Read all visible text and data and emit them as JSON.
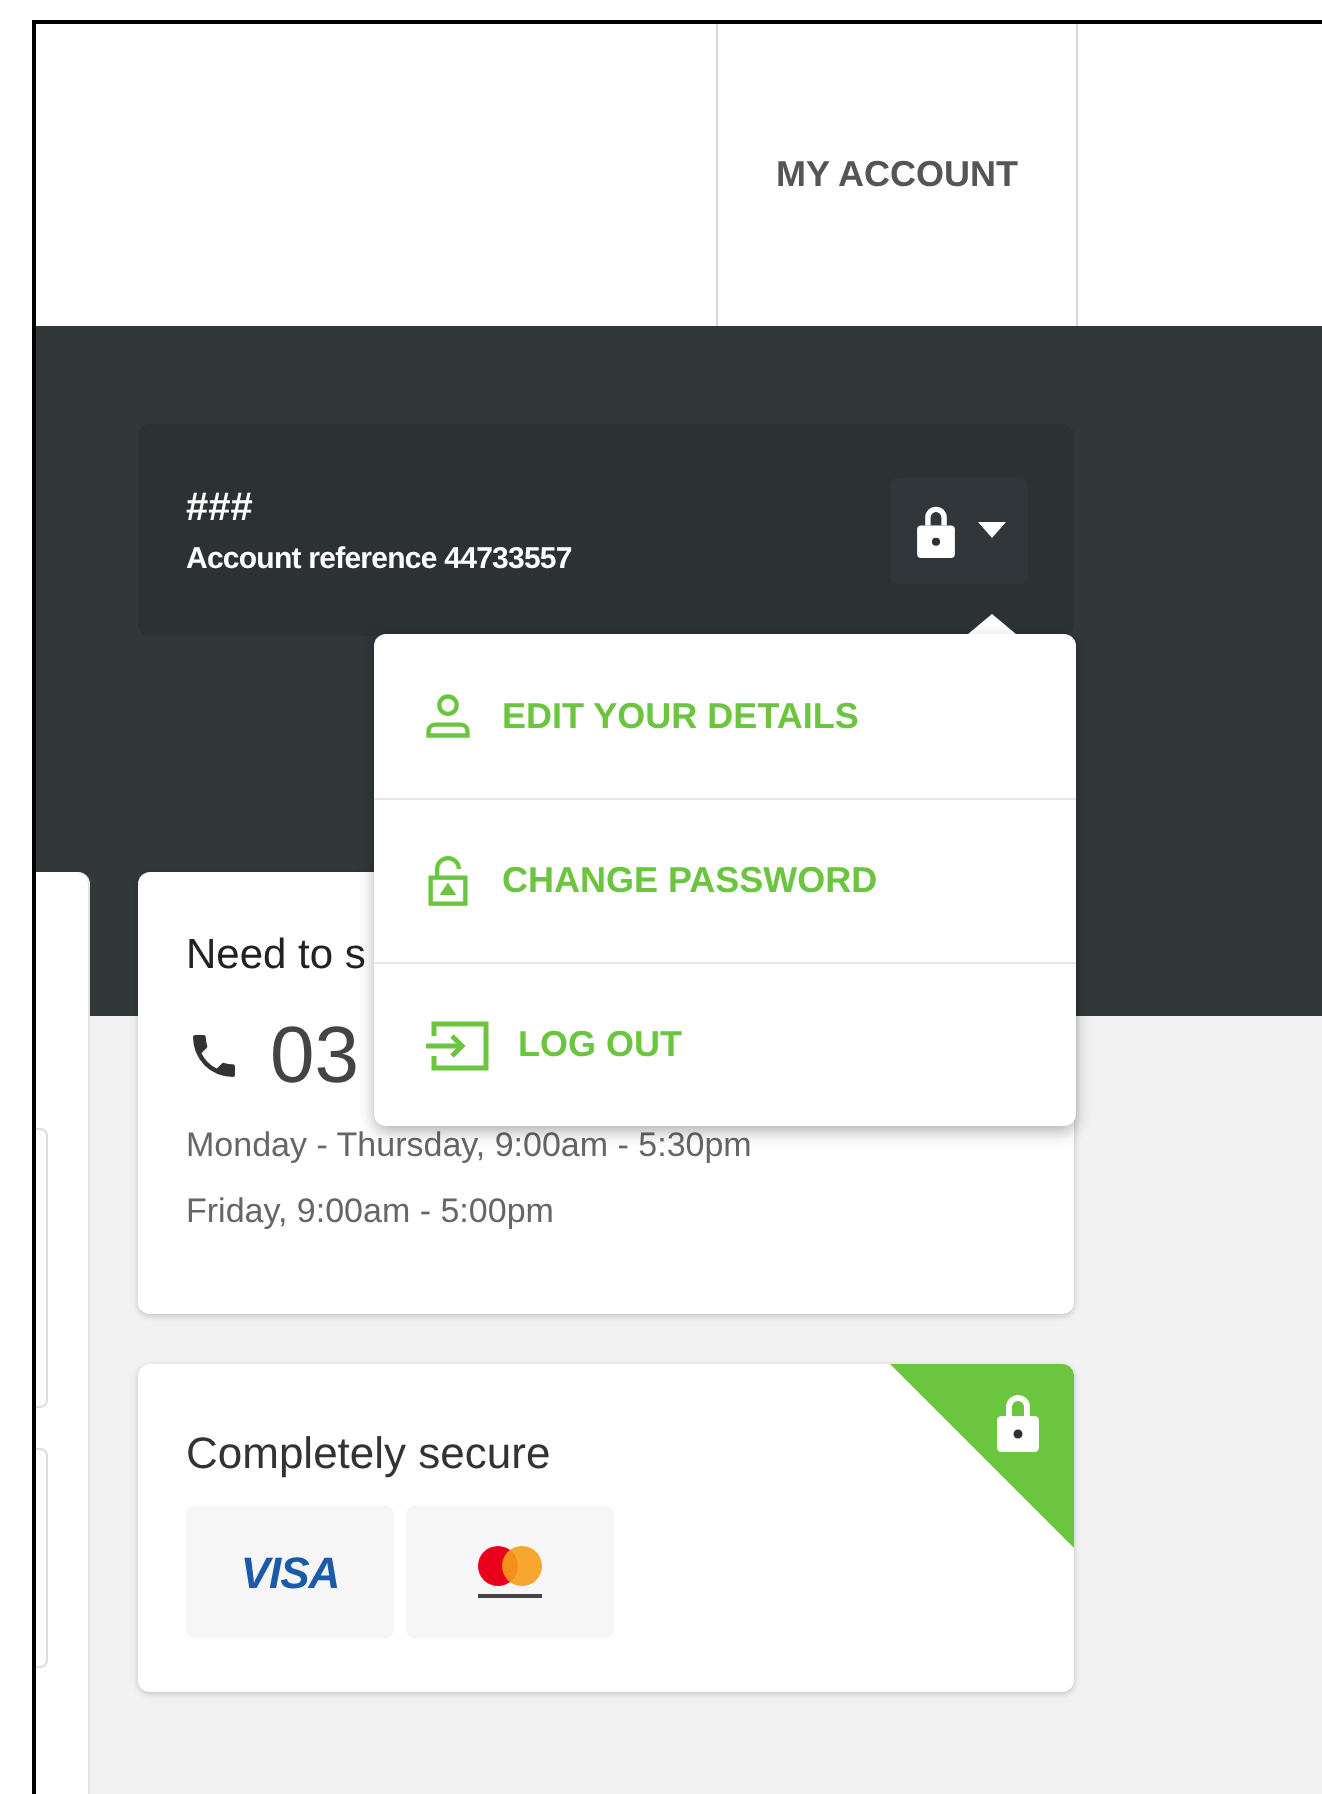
{
  "nav": {
    "items": [
      {
        "label": "MY ACCOUNT"
      }
    ]
  },
  "account": {
    "name": "###",
    "reference": "Account reference 44733557",
    "menu_open": true
  },
  "account_menu": {
    "items": [
      {
        "kind": "person",
        "label": "EDIT YOUR DETAILS"
      },
      {
        "kind": "lock",
        "label": "CHANGE PASSWORD"
      },
      {
        "kind": "logout",
        "label": "LOG OUT"
      }
    ]
  },
  "support": {
    "title": "Need to s",
    "phone": "03",
    "hours": [
      "Monday - Thursday, 9:00am - 5:30pm",
      "Friday, 9:00am - 5:00pm"
    ]
  },
  "secure": {
    "title": "Completely secure",
    "payment_methods": [
      {
        "kind": "visa",
        "label": "VISA"
      },
      {
        "kind": "mastercard"
      }
    ]
  }
}
